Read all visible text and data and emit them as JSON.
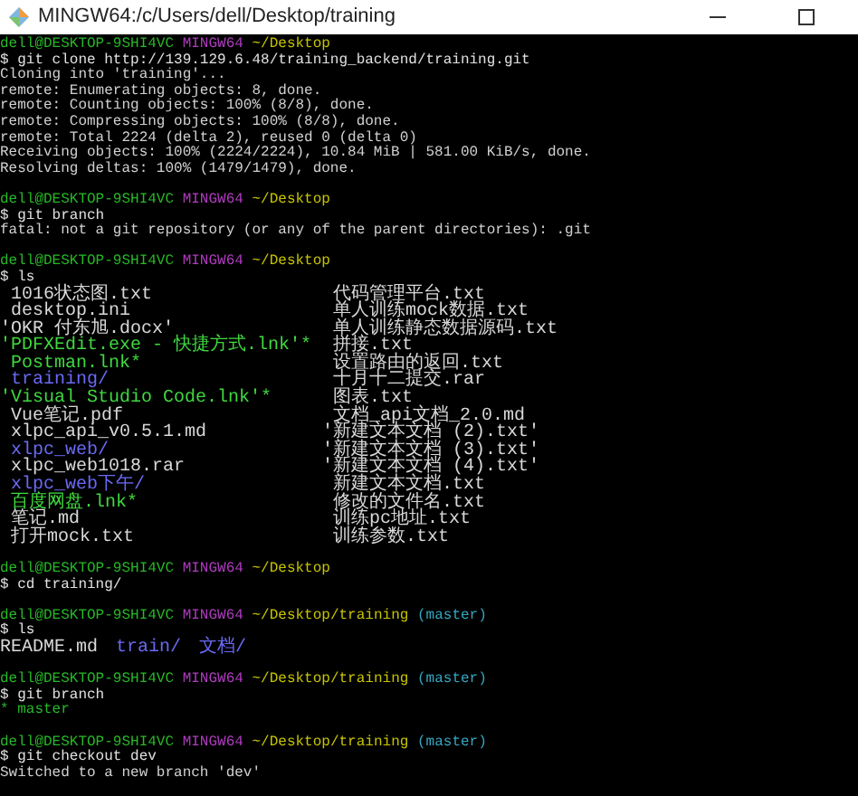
{
  "window": {
    "title": "MINGW64:/c/Users/dell/Desktop/training"
  },
  "terminal": [
    {
      "kind": "prompt",
      "user_host": "dell@DESKTOP-9SHI4VC",
      "shell": "MINGW64",
      "path": "~/Desktop"
    },
    {
      "kind": "command",
      "text": "$ git clone http://139.129.6.48/training_backend/training.git"
    },
    {
      "kind": "output",
      "text": "Cloning into 'training'..."
    },
    {
      "kind": "output",
      "text": "remote: Enumerating objects: 8, done."
    },
    {
      "kind": "output",
      "text": "remote: Counting objects: 100% (8/8), done."
    },
    {
      "kind": "output",
      "text": "remote: Compressing objects: 100% (8/8), done."
    },
    {
      "kind": "output",
      "text": "remote: Total 2224 (delta 2), reused 0 (delta 0)"
    },
    {
      "kind": "output",
      "text": "Receiving objects: 100% (2224/2224), 10.84 MiB | 581.00 KiB/s, done."
    },
    {
      "kind": "output",
      "text": "Resolving deltas: 100% (1479/1479), done."
    },
    {
      "kind": "blank"
    },
    {
      "kind": "prompt",
      "user_host": "dell@DESKTOP-9SHI4VC",
      "shell": "MINGW64",
      "path": "~/Desktop"
    },
    {
      "kind": "command",
      "text": "$ git branch"
    },
    {
      "kind": "output",
      "text": "fatal: not a git repository (or any of the parent directories): .git"
    },
    {
      "kind": "blank"
    },
    {
      "kind": "prompt",
      "user_host": "dell@DESKTOP-9SHI4VC",
      "shell": "MINGW64",
      "path": "~/Desktop"
    },
    {
      "kind": "command",
      "text": "$ ls"
    },
    {
      "kind": "ls_grid",
      "rows": [
        [
          {
            "name": " 1016状态图.txt",
            "kind": "file"
          },
          {
            "name": " 代码管理平台.txt",
            "kind": "file"
          }
        ],
        [
          {
            "name": " desktop.ini",
            "kind": "file"
          },
          {
            "name": " 单人训练mock数据.txt",
            "kind": "file"
          }
        ],
        [
          {
            "name": "'OKR 付东旭.docx'",
            "kind": "file"
          },
          {
            "name": " 单人训练静态数据源码.txt",
            "kind": "file"
          }
        ],
        [
          {
            "name": "'PDFXEdit.exe - 快捷方式.lnk'*",
            "kind": "link"
          },
          {
            "name": " 拼接.txt",
            "kind": "file"
          }
        ],
        [
          {
            "name": " Postman.lnk*",
            "kind": "link"
          },
          {
            "name": " 设置路由的返回.txt",
            "kind": "file"
          }
        ],
        [
          {
            "name": " training/",
            "kind": "dir"
          },
          {
            "name": " 十月十二提交.rar",
            "kind": "file"
          }
        ],
        [
          {
            "name": "'Visual Studio Code.lnk'*",
            "kind": "link"
          },
          {
            "name": " 图表.txt",
            "kind": "file"
          }
        ],
        [
          {
            "name": " Vue笔记.pdf",
            "kind": "file"
          },
          {
            "name": " 文档_api文档_2.0.md",
            "kind": "file"
          }
        ],
        [
          {
            "name": " xlpc_api_v0.5.1.md",
            "kind": "file"
          },
          {
            "name": "'新建文本文档 (2).txt'",
            "kind": "file"
          }
        ],
        [
          {
            "name": " xlpc_web/",
            "kind": "dir"
          },
          {
            "name": "'新建文本文档 (3).txt'",
            "kind": "file"
          }
        ],
        [
          {
            "name": " xlpc_web1018.rar",
            "kind": "file"
          },
          {
            "name": "'新建文本文档 (4).txt'",
            "kind": "file"
          }
        ],
        [
          {
            "name": " xlpc_web下午/",
            "kind": "dir"
          },
          {
            "name": " 新建文本文档.txt",
            "kind": "file"
          }
        ],
        [
          {
            "name": " 百度网盘.lnk*",
            "kind": "link"
          },
          {
            "name": " 修改的文件名.txt",
            "kind": "file"
          }
        ],
        [
          {
            "name": " 笔记.md",
            "kind": "file"
          },
          {
            "name": " 训练pc地址.txt",
            "kind": "file"
          }
        ],
        [
          {
            "name": " 打开mock.txt",
            "kind": "file"
          },
          {
            "name": " 训练参数.txt",
            "kind": "file"
          }
        ]
      ]
    },
    {
      "kind": "blank"
    },
    {
      "kind": "prompt",
      "user_host": "dell@DESKTOP-9SHI4VC",
      "shell": "MINGW64",
      "path": "~/Desktop"
    },
    {
      "kind": "command",
      "text": "$ cd training/"
    },
    {
      "kind": "blank"
    },
    {
      "kind": "prompt",
      "user_host": "dell@DESKTOP-9SHI4VC",
      "shell": "MINGW64",
      "path": "~/Desktop/training",
      "branch": "(master)"
    },
    {
      "kind": "command",
      "text": "$ ls"
    },
    {
      "kind": "ls_line",
      "entries": [
        {
          "name": "README.md",
          "kind": "file"
        },
        {
          "name": "train/",
          "kind": "dir"
        },
        {
          "name": "文档/",
          "kind": "dir"
        }
      ]
    },
    {
      "kind": "blank"
    },
    {
      "kind": "prompt",
      "user_host": "dell@DESKTOP-9SHI4VC",
      "shell": "MINGW64",
      "path": "~/Desktop/training",
      "branch": "(master)"
    },
    {
      "kind": "command",
      "text": "$ git branch"
    },
    {
      "kind": "branch",
      "text": "* master",
      "current": true
    },
    {
      "kind": "blank"
    },
    {
      "kind": "prompt",
      "user_host": "dell@DESKTOP-9SHI4VC",
      "shell": "MINGW64",
      "path": "~/Desktop/training",
      "branch": "(master)"
    },
    {
      "kind": "command",
      "text": "$ git checkout dev"
    },
    {
      "kind": "output",
      "text": "Switched to a new branch 'dev'"
    }
  ]
}
